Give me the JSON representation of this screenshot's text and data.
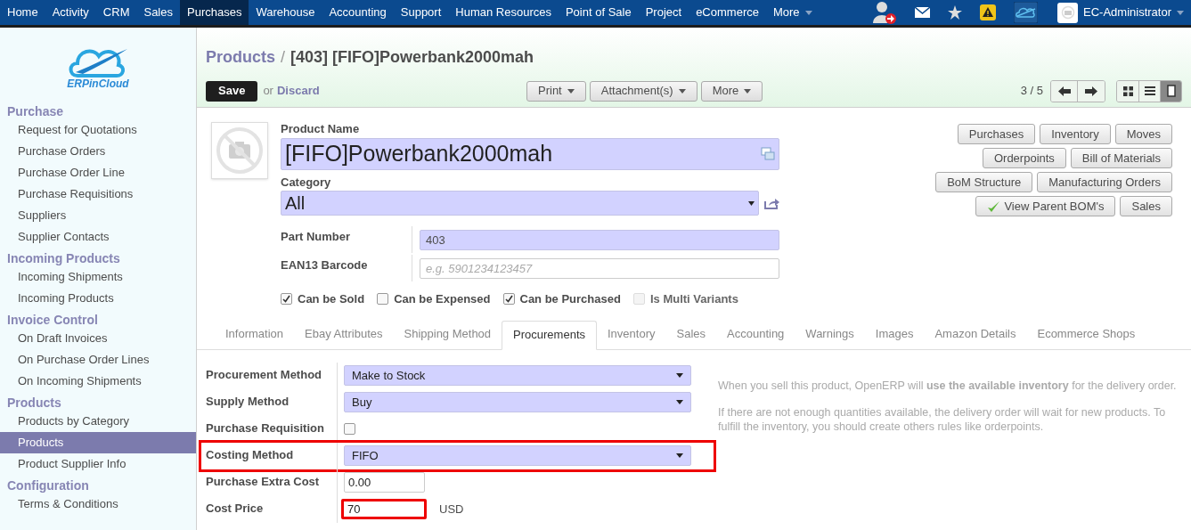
{
  "top_menu": [
    {
      "label": "Home",
      "selected": false
    },
    {
      "label": "Activity",
      "selected": false
    },
    {
      "label": "CRM",
      "selected": false
    },
    {
      "label": "Sales",
      "selected": false
    },
    {
      "label": "Purchases",
      "selected": true
    },
    {
      "label": "Warehouse",
      "selected": false
    },
    {
      "label": "Accounting",
      "selected": false
    },
    {
      "label": "Support",
      "selected": false
    },
    {
      "label": "Human Resources",
      "selected": false
    },
    {
      "label": "Point of Sale",
      "selected": false
    },
    {
      "label": "Project",
      "selected": false
    },
    {
      "label": "eCommerce",
      "selected": false
    },
    {
      "label": "More",
      "selected": false
    }
  ],
  "user": {
    "name": "EC-Administrator"
  },
  "logo": {
    "text": "ERPinCloud"
  },
  "sidebar": [
    {
      "title": "Purchase",
      "items": [
        {
          "label": "Request for Quotations",
          "selected": false
        },
        {
          "label": "Purchase Orders",
          "selected": false
        },
        {
          "label": "Purchase Order Line",
          "selected": false
        },
        {
          "label": "Purchase Requisitions",
          "selected": false
        },
        {
          "label": "Suppliers",
          "selected": false
        },
        {
          "label": "Supplier Contacts",
          "selected": false
        }
      ]
    },
    {
      "title": "Incoming Products",
      "items": [
        {
          "label": "Incoming Shipments",
          "selected": false
        },
        {
          "label": "Incoming Products",
          "selected": false
        }
      ]
    },
    {
      "title": "Invoice Control",
      "items": [
        {
          "label": "On Draft Invoices",
          "selected": false
        },
        {
          "label": "On Purchase Order Lines",
          "selected": false
        },
        {
          "label": "On Incoming Shipments",
          "selected": false
        }
      ]
    },
    {
      "title": "Products",
      "items": [
        {
          "label": "Products by Category",
          "selected": false
        },
        {
          "label": "Products",
          "selected": true
        },
        {
          "label": "Product Supplier Info",
          "selected": false
        }
      ]
    },
    {
      "title": "Configuration",
      "items": [
        {
          "label": "Terms & Conditions",
          "selected": false
        }
      ]
    }
  ],
  "breadcrumb": {
    "parent": "Products",
    "separator": "/",
    "current": "[403] [FIFO]Powerbank2000mah"
  },
  "actions": {
    "save": "Save",
    "or": "or",
    "discard": "Discard",
    "menus": [
      "Print",
      "Attachment(s)",
      "More"
    ],
    "pager": "3 / 5"
  },
  "views": [
    {
      "kind": "kanban",
      "selected": false
    },
    {
      "kind": "list",
      "selected": false
    },
    {
      "kind": "form",
      "selected": true
    }
  ],
  "product": {
    "name_label": "Product Name",
    "name": "[FIFO]Powerbank2000mah",
    "category_label": "Category",
    "category": "All",
    "fields": [
      {
        "label": "Part Number",
        "value": "403",
        "required": true
      },
      {
        "label": "EAN13 Barcode",
        "placeholder": "e.g. 5901234123457",
        "required": false
      }
    ],
    "flags": [
      {
        "label": "Can be Sold",
        "checked": true,
        "disabled": false
      },
      {
        "label": "Can be Expensed",
        "checked": false,
        "disabled": false
      },
      {
        "label": "Can be Purchased",
        "checked": true,
        "disabled": false
      },
      {
        "label": "Is Multi Variants",
        "checked": false,
        "disabled": true
      }
    ]
  },
  "smart_buttons": [
    [
      "Purchases",
      "Inventory",
      "Moves"
    ],
    [
      "Orderpoints",
      "Bill of Materials"
    ],
    [
      "BoM Structure",
      "Manufacturing Orders"
    ],
    [
      "View Parent BOM's",
      "Sales"
    ]
  ],
  "tabs": [
    {
      "label": "Information",
      "selected": false
    },
    {
      "label": "Ebay Attributes",
      "selected": false
    },
    {
      "label": "Shipping Method",
      "selected": false
    },
    {
      "label": "Procurements",
      "selected": true
    },
    {
      "label": "Inventory",
      "selected": false
    },
    {
      "label": "Sales",
      "selected": false
    },
    {
      "label": "Accounting",
      "selected": false
    },
    {
      "label": "Warnings",
      "selected": false
    },
    {
      "label": "Images",
      "selected": false
    },
    {
      "label": "Amazon Details",
      "selected": false
    },
    {
      "label": "Ecommerce Shops",
      "selected": false
    }
  ],
  "procurement": [
    {
      "label": "Procurement Method",
      "kind": "select",
      "value": "Make to Stock",
      "highlighted": false
    },
    {
      "label": "Supply Method",
      "kind": "select",
      "value": "Buy",
      "highlighted": false
    },
    {
      "label": "Purchase Requisition",
      "kind": "checkbox",
      "checked": false,
      "highlighted": false
    },
    {
      "label": "Costing Method",
      "kind": "select",
      "value": "FIFO",
      "highlighted": true
    },
    {
      "label": "Purchase Extra Cost",
      "kind": "input",
      "value": "0.00",
      "highlighted": false
    },
    {
      "label": "Cost Price",
      "kind": "input",
      "value": "70",
      "unit": "USD",
      "highlighted": true
    }
  ],
  "help": [
    "When you sell this product, OpenERP will **use the available inventory** for the delivery order.",
    "If there are not enough quantities available, the delivery order will wait for new products. To fulfill the inventory, you should create others rules like orderpoints."
  ]
}
